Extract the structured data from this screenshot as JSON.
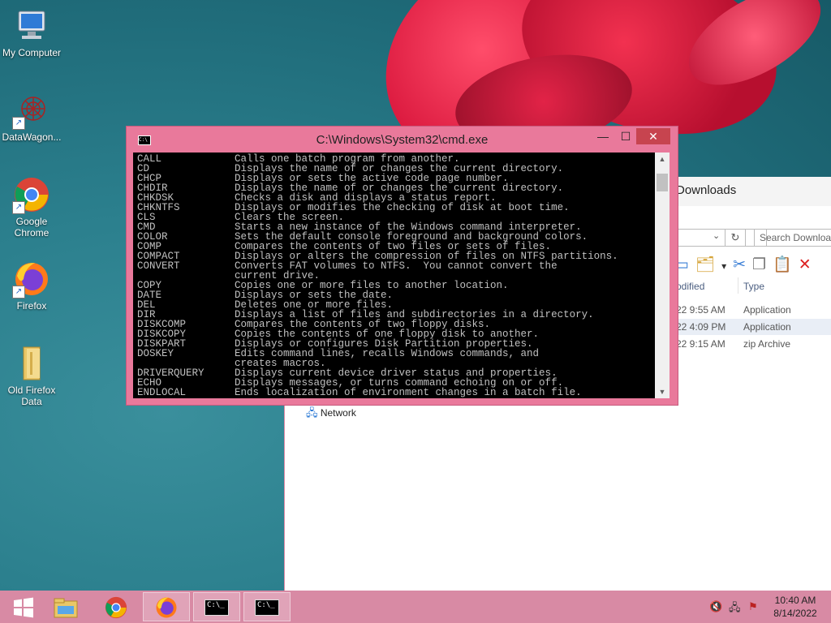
{
  "desktop": {
    "icons": [
      {
        "label": "My Computer"
      },
      {
        "label": "DataWagon..."
      },
      {
        "label": "Google Chrome"
      },
      {
        "label": "Firefox"
      },
      {
        "label": "Old Firefox Data"
      }
    ]
  },
  "explorer": {
    "title": "Downloads",
    "search_placeholder": "Search Downloads",
    "refresh_icon": "↻",
    "col_modified": "odified",
    "col_type": "Type",
    "rows": [
      {
        "date": "22 9:55 AM",
        "type": "Application"
      },
      {
        "date": "22 4:09 PM",
        "type": "Application"
      },
      {
        "date": "22 9:15 AM",
        "type": "zip Archive"
      }
    ],
    "nav_network": "Network"
  },
  "cmd": {
    "title": "C:\\Windows\\System32\\cmd.exe",
    "icon_text": "C:\\",
    "minimize": "—",
    "maximize": "☐",
    "close": "✕",
    "lines": [
      {
        "name": "CALL",
        "desc": "Calls one batch program from another."
      },
      {
        "name": "CD",
        "desc": "Displays the name of or changes the current directory."
      },
      {
        "name": "CHCP",
        "desc": "Displays or sets the active code page number."
      },
      {
        "name": "CHDIR",
        "desc": "Displays the name of or changes the current directory."
      },
      {
        "name": "CHKDSK",
        "desc": "Checks a disk and displays a status report."
      },
      {
        "name": "CHKNTFS",
        "desc": "Displays or modifies the checking of disk at boot time."
      },
      {
        "name": "CLS",
        "desc": "Clears the screen."
      },
      {
        "name": "CMD",
        "desc": "Starts a new instance of the Windows command interpreter."
      },
      {
        "name": "COLOR",
        "desc": "Sets the default console foreground and background colors."
      },
      {
        "name": "COMP",
        "desc": "Compares the contents of two files or sets of files."
      },
      {
        "name": "COMPACT",
        "desc": "Displays or alters the compression of files on NTFS partitions."
      },
      {
        "name": "CONVERT",
        "desc": "Converts FAT volumes to NTFS.  You cannot convert the"
      },
      {
        "name": "",
        "desc": "current drive."
      },
      {
        "name": "COPY",
        "desc": "Copies one or more files to another location."
      },
      {
        "name": "DATE",
        "desc": "Displays or sets the date."
      },
      {
        "name": "DEL",
        "desc": "Deletes one or more files."
      },
      {
        "name": "DIR",
        "desc": "Displays a list of files and subdirectories in a directory."
      },
      {
        "name": "DISKCOMP",
        "desc": "Compares the contents of two floppy disks."
      },
      {
        "name": "DISKCOPY",
        "desc": "Copies the contents of one floppy disk to another."
      },
      {
        "name": "DISKPART",
        "desc": "Displays or configures Disk Partition properties."
      },
      {
        "name": "DOSKEY",
        "desc": "Edits command lines, recalls Windows commands, and"
      },
      {
        "name": "",
        "desc": "creates macros."
      },
      {
        "name": "DRIVERQUERY",
        "desc": "Displays current device driver status and properties."
      },
      {
        "name": "ECHO",
        "desc": "Displays messages, or turns command echoing on or off."
      },
      {
        "name": "ENDLOCAL",
        "desc": "Ends localization of environment changes in a batch file."
      }
    ]
  },
  "taskbar": {
    "start_icon": "start-icon",
    "clock_time": "10:40 AM",
    "clock_date": "8/14/2022",
    "cmd_icon_text": "C:\\_"
  },
  "colors": {
    "accent": "#e9799b",
    "taskbar": "#d88aa4",
    "console_bg": "#000000",
    "console_fg": "#c0c0c0"
  }
}
